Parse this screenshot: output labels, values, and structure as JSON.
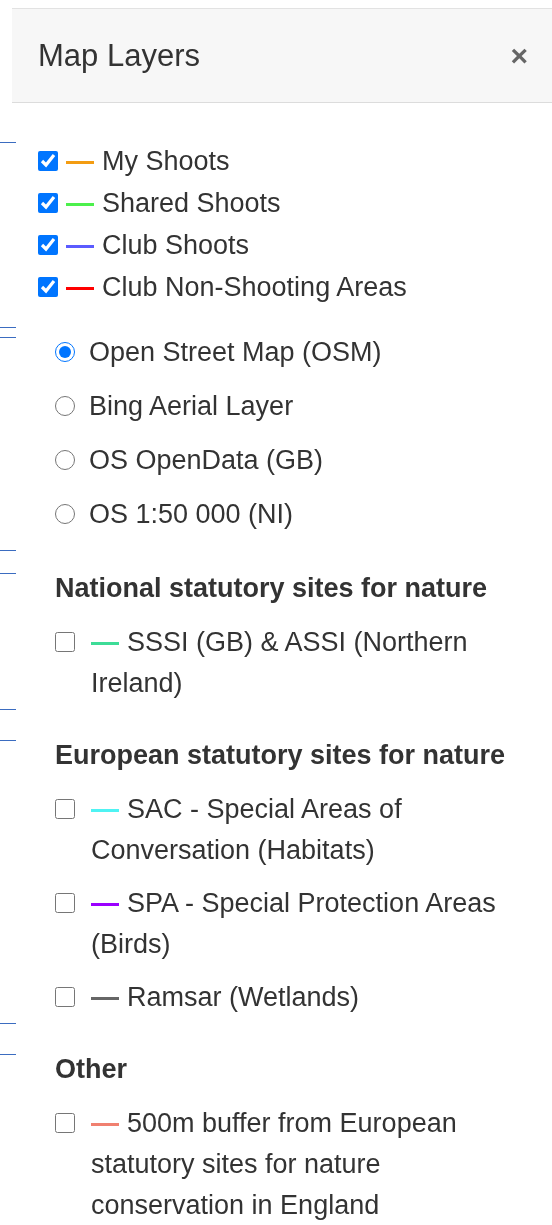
{
  "header": {
    "title": "Map Layers",
    "close": "×"
  },
  "layers": [
    {
      "label": "My Shoots",
      "color": "#f39c12",
      "checked": true
    },
    {
      "label": "Shared Shoots",
      "color": "#4cf04c",
      "checked": true
    },
    {
      "label": "Club Shoots",
      "color": "#5b5bff",
      "checked": true
    },
    {
      "label": "Club Non-Shooting Areas",
      "color": "#ff0000",
      "checked": true
    }
  ],
  "basemaps": [
    {
      "label": "Open Street Map (OSM)",
      "selected": true
    },
    {
      "label": "Bing Aerial Layer",
      "selected": false
    },
    {
      "label": "OS OpenData (GB)",
      "selected": false
    },
    {
      "label": "OS 1:50 000 (NI)",
      "selected": false
    }
  ],
  "sections": [
    {
      "heading": "National statutory sites for nature",
      "items": [
        {
          "label": "SSSI (GB) & ASSI (Northern Ireland)",
          "color": "#3ddc97",
          "checked": false
        }
      ]
    },
    {
      "heading": "European statutory sites for nature",
      "items": [
        {
          "label": "SAC - Special Areas of Conversation (Habitats)",
          "color": "#4ff3f3",
          "checked": false
        },
        {
          "label": "SPA - Special Protection Areas (Birds)",
          "color": "#9b00ff",
          "checked": false
        },
        {
          "label": "Ramsar (Wetlands)",
          "color": "#666666",
          "checked": false
        }
      ]
    },
    {
      "heading": "Other",
      "items": [
        {
          "label": "500m buffer from European statutory sites for nature conservation in England",
          "color": "#f08070",
          "checked": false
        }
      ]
    }
  ]
}
